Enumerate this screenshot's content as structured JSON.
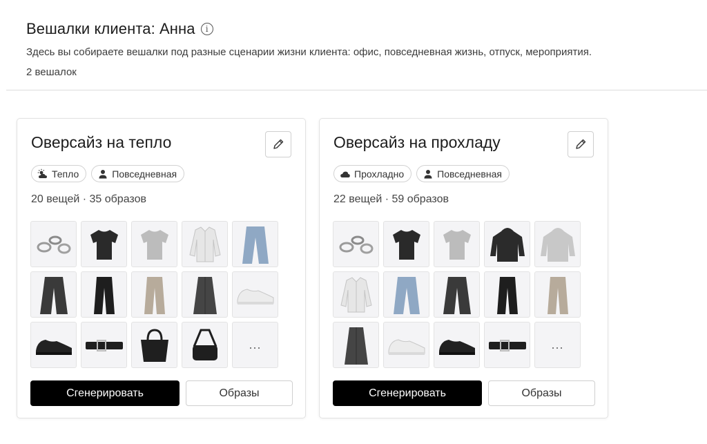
{
  "header": {
    "title": "Вешалки клиента: Анна",
    "info_icon": "info-circle-icon",
    "subtitle": "Здесь вы собираете вешалки под разные сценарии жизни клиента: офис, повседневная жизнь, отпуск, мероприятия.",
    "count": "2 вешалок"
  },
  "cards": [
    {
      "title": "Оверсайз на тепло",
      "tags": [
        {
          "icon": "sun-cloud-icon",
          "label": "Тепло"
        },
        {
          "icon": "person-icon",
          "label": "Повседневная"
        }
      ],
      "stats": "20 вещей · 35 образов",
      "items": [
        "rings",
        "tshirt-black",
        "tshirt-grey",
        "shirt-white",
        "jeans-light",
        "pants-black-wide",
        "pants-black",
        "pants-beige",
        "skirt-denim",
        "sneakers-white",
        "sneakers-black",
        "belt",
        "tote-bag",
        "crossbody-bag"
      ],
      "more_label": "...",
      "generate_label": "Сгенерировать",
      "looks_label": "Образы"
    },
    {
      "title": "Оверсайз на прохладу",
      "tags": [
        {
          "icon": "cloud-icon",
          "label": "Прохладно"
        },
        {
          "icon": "person-icon",
          "label": "Повседневная"
        }
      ],
      "stats": "22 вещей · 59 образов",
      "items": [
        "rings",
        "tshirt-black",
        "tshirt-grey",
        "hoodie-black",
        "hoodie-grey",
        "shirt-white",
        "jeans-light",
        "pants-black-wide",
        "pants-black",
        "pants-beige",
        "skirt-denim",
        "sneakers-white",
        "sneakers-black",
        "belt"
      ],
      "more_label": "...",
      "generate_label": "Сгенерировать",
      "looks_label": "Образы"
    }
  ]
}
